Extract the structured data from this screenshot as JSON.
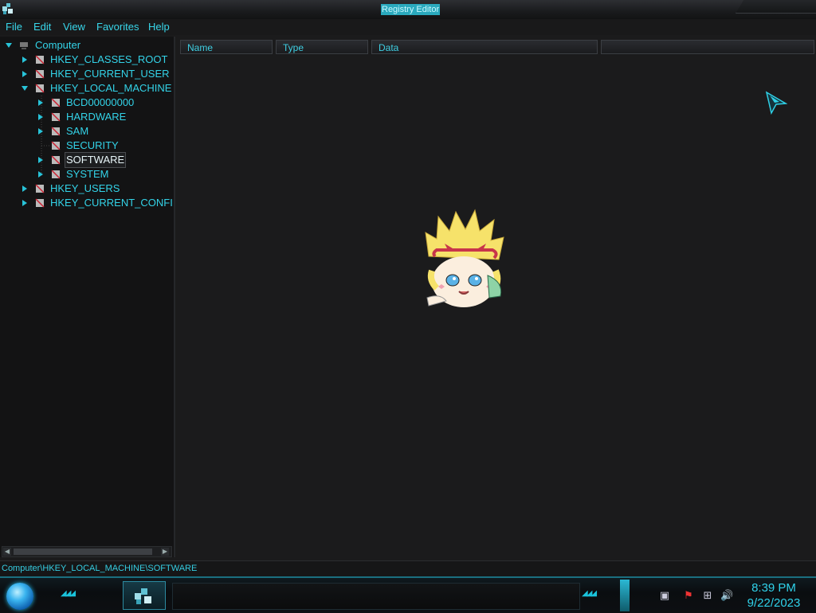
{
  "window": {
    "title": "Registry Editor"
  },
  "menu": [
    "File",
    "Edit",
    "View",
    "Favorites",
    "Help"
  ],
  "tree": {
    "root": "Computer",
    "items": [
      {
        "label": "HKEY_CLASSES_ROOT",
        "level": 1,
        "expandable": true,
        "expanded": false
      },
      {
        "label": "HKEY_CURRENT_USER",
        "level": 1,
        "expandable": true,
        "expanded": false
      },
      {
        "label": "HKEY_LOCAL_MACHINE",
        "level": 1,
        "expandable": true,
        "expanded": true
      },
      {
        "label": "BCD00000000",
        "level": 2,
        "expandable": true,
        "expanded": false
      },
      {
        "label": "HARDWARE",
        "level": 2,
        "expandable": true,
        "expanded": false
      },
      {
        "label": "SAM",
        "level": 2,
        "expandable": true,
        "expanded": false
      },
      {
        "label": "SECURITY",
        "level": 2,
        "expandable": false,
        "expanded": false
      },
      {
        "label": "SOFTWARE",
        "level": 2,
        "expandable": true,
        "expanded": false,
        "selected": true
      },
      {
        "label": "SYSTEM",
        "level": 2,
        "expandable": true,
        "expanded": false
      },
      {
        "label": "HKEY_USERS",
        "level": 1,
        "expandable": true,
        "expanded": false
      },
      {
        "label": "HKEY_CURRENT_CONFI",
        "level": 1,
        "expandable": true,
        "expanded": false
      }
    ]
  },
  "list": {
    "columns": [
      "Name",
      "Type",
      "Data",
      ""
    ]
  },
  "status": {
    "path": "Computer\\HKEY_LOCAL_MACHINE\\SOFTWARE"
  },
  "taskbar": {
    "clock_time": "8:39 PM",
    "clock_date": "9/22/2023",
    "tray_icons": [
      "show-desktop-icon",
      "flag-error-icon",
      "network-icon",
      "volume-icon"
    ]
  },
  "colors": {
    "accent": "#33d3e8",
    "background": "#1b1b1c",
    "tree_background": "#131314"
  }
}
